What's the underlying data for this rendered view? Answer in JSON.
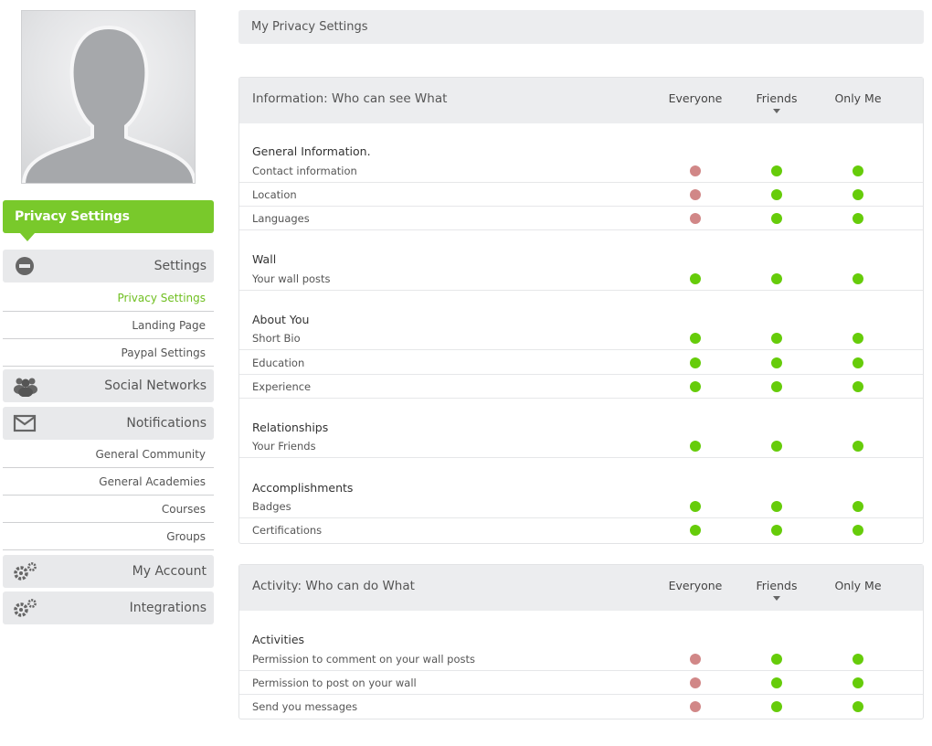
{
  "sidebar": {
    "active_tab": "Privacy Settings",
    "menu": [
      {
        "label": "Settings",
        "icon": "minus-circle-icon"
      },
      {
        "label": "Social Networks",
        "icon": "users-icon"
      },
      {
        "label": "Notifications",
        "icon": "envelope-icon"
      },
      {
        "label": "My Account",
        "icon": "gears-icon"
      },
      {
        "label": "Integrations",
        "icon": "gears-icon"
      }
    ],
    "settings_sub": [
      "Privacy Settings",
      "Landing Page",
      "Paypal Settings"
    ],
    "notifications_sub": [
      "General Community",
      "General Academies",
      "Courses",
      "Groups"
    ]
  },
  "main": {
    "title": "My Privacy Settings",
    "columns": [
      "Everyone",
      "Friends",
      "Only Me"
    ],
    "info_panel": {
      "title": "Information: Who can see What",
      "sections": [
        {
          "title": "General Information.",
          "rows": [
            {
              "label": "Contact information",
              "values": [
                "red",
                "green",
                "green"
              ]
            },
            {
              "label": "Location",
              "values": [
                "red",
                "green",
                "green"
              ]
            },
            {
              "label": "Languages",
              "values": [
                "red",
                "green",
                "green"
              ]
            }
          ]
        },
        {
          "title": "Wall",
          "rows": [
            {
              "label": "Your wall posts",
              "values": [
                "green",
                "green",
                "green"
              ]
            }
          ]
        },
        {
          "title": "About You",
          "rows": [
            {
              "label": "Short Bio",
              "values": [
                "green",
                "green",
                "green"
              ]
            },
            {
              "label": "Education",
              "values": [
                "green",
                "green",
                "green"
              ]
            },
            {
              "label": "Experience",
              "values": [
                "green",
                "green",
                "green"
              ]
            }
          ]
        },
        {
          "title": "Relationships",
          "rows": [
            {
              "label": "Your Friends",
              "values": [
                "green",
                "green",
                "green"
              ]
            }
          ]
        },
        {
          "title": "Accomplishments",
          "rows": [
            {
              "label": "Badges",
              "values": [
                "green",
                "green",
                "green"
              ]
            },
            {
              "label": "Certifications",
              "values": [
                "green",
                "green",
                "green"
              ]
            }
          ]
        }
      ]
    },
    "activity_panel": {
      "title": "Activity: Who can do What",
      "sections": [
        {
          "title": "Activities",
          "rows": [
            {
              "label": "Permission to comment on your wall posts",
              "values": [
                "red",
                "green",
                "green"
              ]
            },
            {
              "label": "Permission to post on your wall",
              "values": [
                "red",
                "green",
                "green"
              ]
            },
            {
              "label": "Send you messages",
              "values": [
                "red",
                "green",
                "green"
              ]
            }
          ]
        }
      ]
    }
  },
  "colors": {
    "accent": "#79c92b",
    "allowed": "#66cc0a",
    "denied": "#d18787"
  }
}
